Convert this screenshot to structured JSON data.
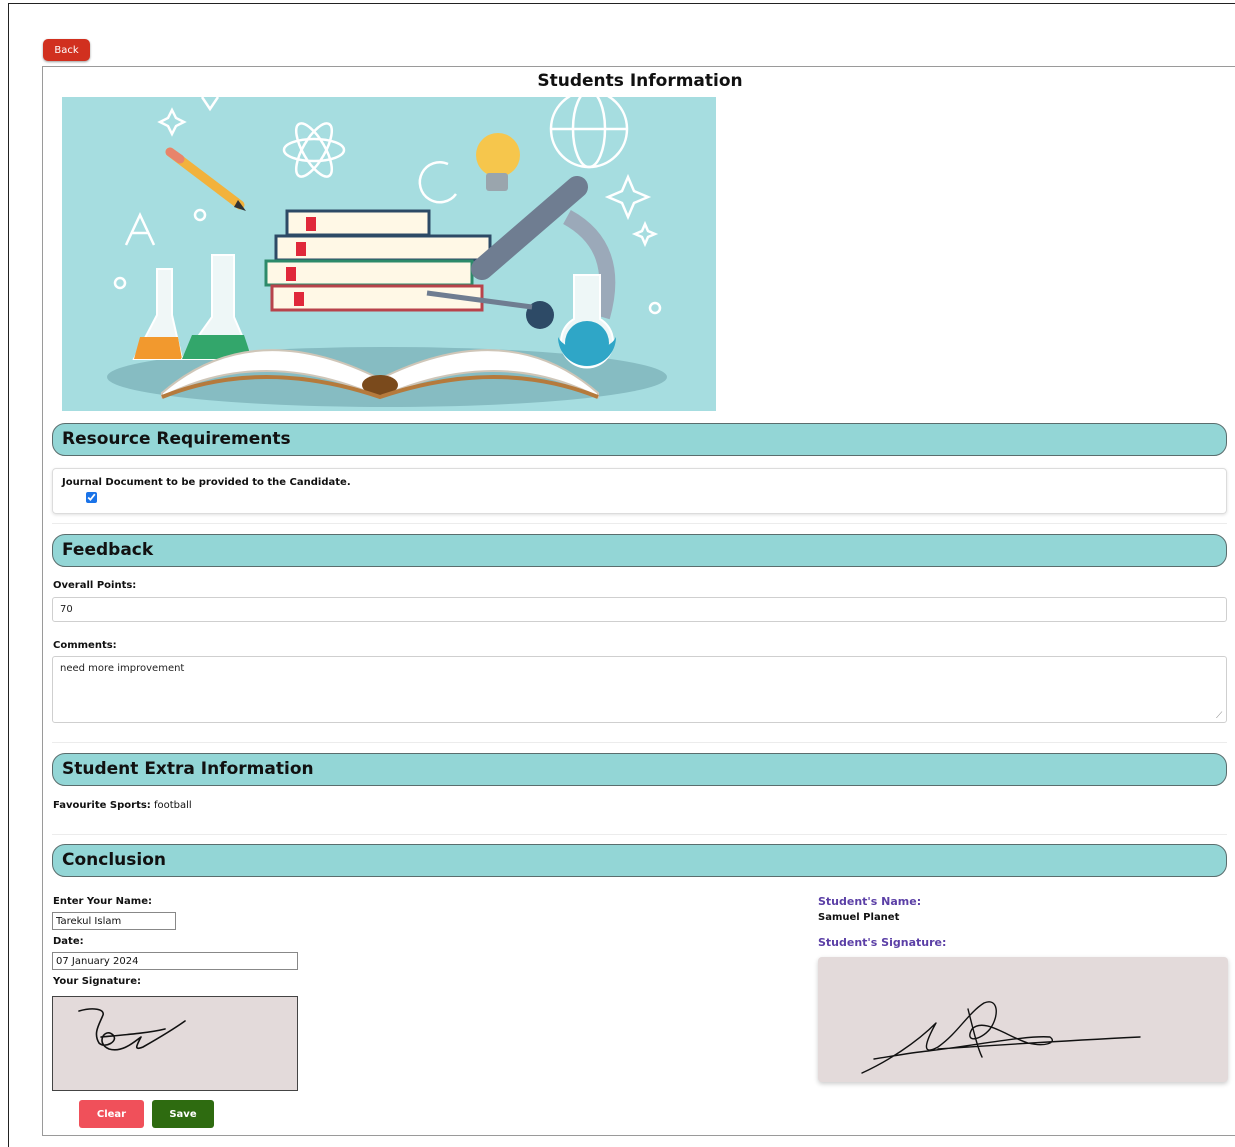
{
  "back_label": "Back",
  "page_title": "Students Information",
  "resource": {
    "heading": "Resource Requirements",
    "journal_label": "Journal Document to be provided to the Candidate.",
    "journal_checked": true
  },
  "feedback": {
    "heading": "Feedback",
    "points_label": "Overall Points:",
    "points_value": "70",
    "comments_label": "Comments:",
    "comments_value": "need more improvement"
  },
  "extra": {
    "heading": "Student Extra Information",
    "sports_label": "Favourite Sports:",
    "sports_value": "football"
  },
  "conclusion": {
    "heading": "Conclusion",
    "name_label": "Enter Your Name:",
    "name_value": "Tarekul Islam",
    "date_label": "Date:",
    "date_value": "07 January 2024",
    "signature_label": "Your Signature:",
    "clear_label": "Clear",
    "save_label": "Save",
    "student_name_label": "Student's Name:",
    "student_name": "Samuel Planet",
    "student_signature_label": "Student's Signature:"
  },
  "colors": {
    "section_bar": "#93d6d6",
    "back_button": "#d1301f",
    "clear_button": "#f0505a",
    "save_button": "#2e6b10",
    "student_label": "#5b3fa6",
    "signature_bg": "#e3dada"
  }
}
